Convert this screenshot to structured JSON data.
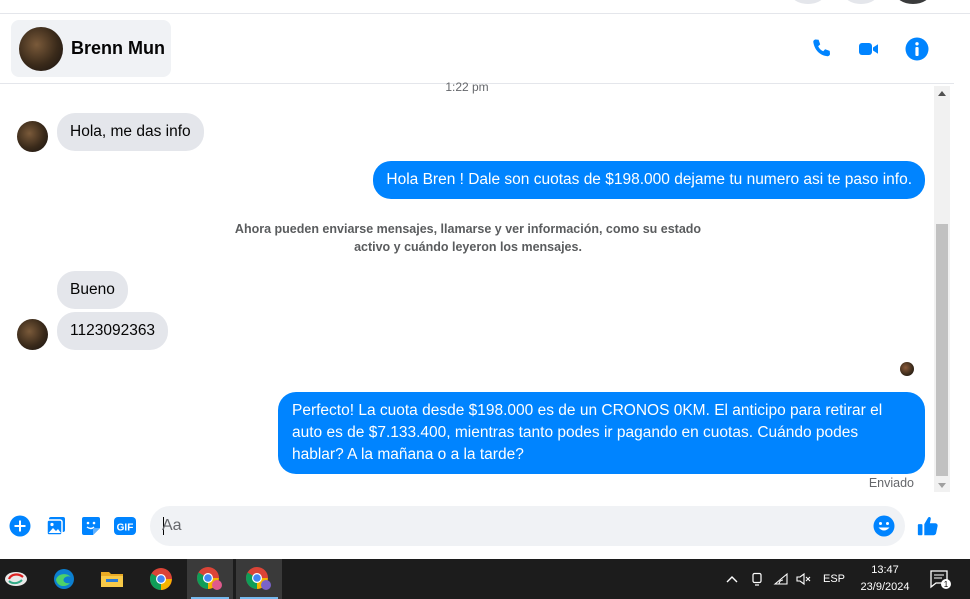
{
  "header": {
    "contact_name": "Brenn Mun",
    "icons": [
      "phone-icon",
      "video-camera-icon",
      "info-icon"
    ],
    "accent_color": "#0084ff"
  },
  "conversation": {
    "timestamp": "1:22 pm",
    "messages": [
      {
        "side": "in",
        "text": "Hola, me das info"
      },
      {
        "side": "out",
        "text": "Hola Bren ! Dale son cuotas de $198.000 dejame tu numero asi te paso info."
      },
      {
        "side": "in",
        "text": "Bueno"
      },
      {
        "side": "in",
        "text": "1123092363"
      },
      {
        "side": "out",
        "text": "Perfecto! La cuota desde $198.000 es de un CRONOS 0KM. El anticipo para retirar el auto es de $7.133.400, mientras tanto podes ir pagando en cuotas. Cuándo podes hablar? A la mañana o a la tarde?"
      }
    ],
    "system_message": "Ahora pueden enviarse mensajes, llamarse y ver información, como su estado activo y cuándo leyeron los mensajes.",
    "status": "Enviado"
  },
  "composer": {
    "placeholder": "Aa",
    "icons": [
      "plus-icon",
      "image-icon",
      "sticker-icon",
      "gif-icon",
      "emoji-icon",
      "thumbs-up-icon"
    ],
    "gif_label": "GIF"
  },
  "taskbar": {
    "apps": [
      "start-icon",
      "edge-icon",
      "file-explorer-icon",
      "chrome-icon",
      "chrome-profile-1-icon",
      "chrome-profile-2-icon"
    ],
    "language": "ESP",
    "time": "13:47",
    "date": "23/9/2024",
    "notification_count": "1"
  }
}
